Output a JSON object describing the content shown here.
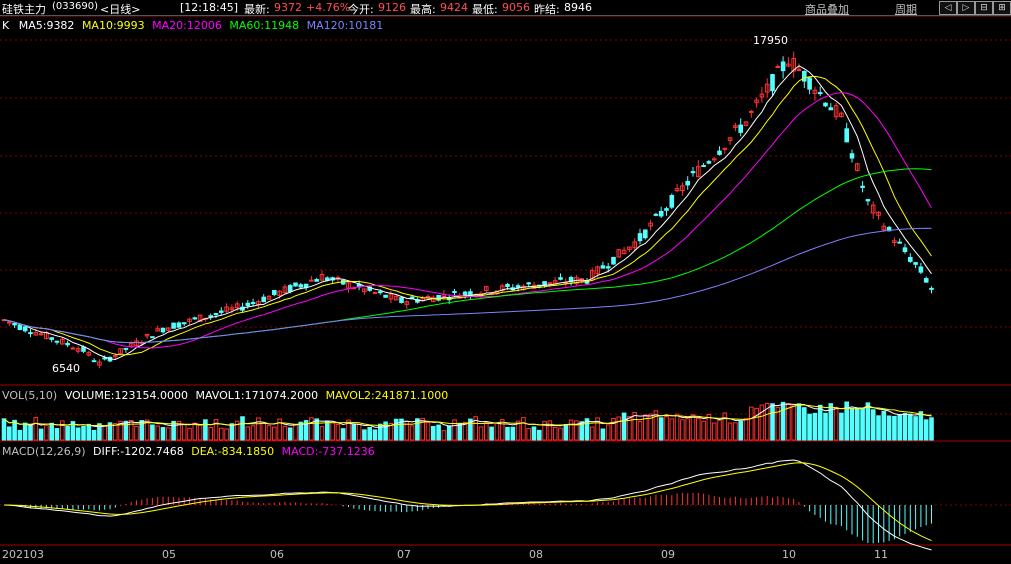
{
  "header": {
    "name": "硅铁主力",
    "code": "(033690)",
    "period": "<日线>",
    "time": "[12:18:45]",
    "last_label": "最新:",
    "last": "9372",
    "change": "+4.76%",
    "open_label": "今开:",
    "open": "9126",
    "high_label": "最高:",
    "high": "9424",
    "low_label": "最低:",
    "low": "9056",
    "prev_label": "昨结:",
    "prev": "8946",
    "overlay_btn": "商品叠加",
    "cycle_btn": "周期",
    "nav": [
      "◁",
      "▷",
      "⊟",
      "⊞"
    ]
  },
  "ma_legend": {
    "k": "K",
    "ma5": "MA5:9382",
    "ma10": "MA10:9993",
    "ma20": "MA20:12006",
    "ma60": "MA60:11948",
    "ma120": "MA120:10181"
  },
  "vol_legend": {
    "name": "VOL(5,10)",
    "volume": "VOLUME:123154.0000",
    "mavol1": "MAVOL1:171074.2000",
    "mavol2": "MAVOL2:241871.1000"
  },
  "macd_legend": {
    "name": "MACD(12,26,9)",
    "diff": "DIFF:-1202.7468",
    "dea": "DEA:-834.1850",
    "macd": "MACD:-737.1236"
  },
  "annotations": {
    "high": "17950",
    "low": "6540"
  },
  "x_axis": [
    "202103",
    "05",
    "06",
    "07",
    "08",
    "09",
    "10",
    "11"
  ],
  "colors": {
    "up": "#ff3232",
    "down": "#54ffff",
    "bg": "#000000",
    "ma5": "#ffffff",
    "ma10": "#ffff00",
    "ma20": "#ff00ff",
    "ma60": "#00ff00",
    "ma120": "#8080ff",
    "grid": "#aa0000"
  }
}
